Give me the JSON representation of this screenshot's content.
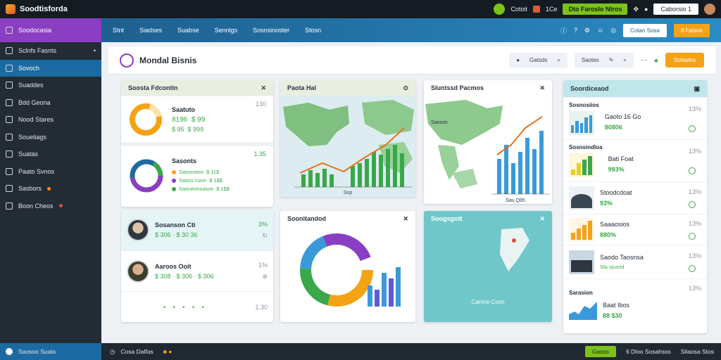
{
  "topbar": {
    "app_title": "Soodtisforda",
    "user_a": "Cotoit",
    "user_b": "1Ce",
    "green_label": "Dto Faroslo Ntros",
    "search_btn": "Caborsio 1"
  },
  "sidebar": {
    "header": "Soodocasia",
    "items": [
      {
        "label": "Sclnfs Fasnts"
      },
      {
        "label": "Sovoch"
      },
      {
        "label": "Suaddes"
      },
      {
        "label": "Bdd Geona"
      },
      {
        "label": "Nood Stares"
      },
      {
        "label": "Souetiags"
      },
      {
        "label": "Suatas"
      },
      {
        "label": "Paato Svnos"
      },
      {
        "label": "Sasbors"
      },
      {
        "label": "Boon Cheos"
      }
    ]
  },
  "nav": {
    "links": [
      "Stnt",
      "Siadses",
      "Suabse",
      "Sennlgs",
      "Sosnsinoster",
      "Stosn"
    ],
    "btn_white": "Cotan Sosa",
    "btn_orange": "8 Fatson"
  },
  "header": {
    "title": "Mondal Bisnis",
    "search1": "Gatsds",
    "search2": "Saotes",
    "stats_btn": "Sotastos"
  },
  "panels": {
    "summary": {
      "title": "Soosta Fdcontin",
      "card1_title": "Saatuto",
      "card1_value": "8196",
      "card1_values": [
        "$ 95",
        "$ 99",
        "$ 999"
      ],
      "card1_side": "130",
      "card2_title": "Sasonts",
      "card2_side": "1.35",
      "legend": [
        "Sasonsioo",
        "$ 11$",
        "Sasos cuon",
        "$ 1$$",
        "Sasneonsasse",
        "$ 1$$"
      ]
    },
    "people": {
      "row1_name": "Sosanson Cti",
      "row1_values": "$ 306 · $ 30 36",
      "row1_side": "3%",
      "row2_name": "Aaroos Ooit",
      "row2_values": "$ 308 · $ 306 · $ 306",
      "row2_side": "1%",
      "row3_side": "1.30"
    },
    "map": {
      "title": "Paota Hal",
      "axis": "Sop"
    },
    "world": {
      "title": "Sluntssd Pacmos",
      "label": "Saoson",
      "footer": "Sau Q95"
    },
    "donut": {
      "title": "Soonitandod"
    },
    "sea": {
      "title": "Soogsgott",
      "label": "Carmoi Coon"
    },
    "right": {
      "title": "Soordiceaod",
      "rows": [
        {
          "title": "Sosnosiios",
          "name": "Gaoto 16 Go",
          "value": "80806",
          "pct": "13%",
          "kind": "bar"
        },
        {
          "title": "Sosnsindloa",
          "name": "Bati Foat",
          "value": "993%",
          "pct": "13%",
          "kind": "bar2"
        },
        {
          "title": "",
          "name": "Stoodcdoat",
          "value": "93%",
          "pct": "13%",
          "kind": "person"
        },
        {
          "title": "",
          "name": "Saaaosios",
          "value": "880%",
          "pct": "13%",
          "kind": "bar3"
        },
        {
          "title": "",
          "name": "Saodo Taosnsa",
          "value": "Sla sjusrid",
          "pct": "13%",
          "kind": "photo"
        },
        {
          "title": "Sarasion",
          "name": "Baat Ibos",
          "value": "88 $30",
          "pct": "13%",
          "kind": "area"
        }
      ]
    }
  },
  "footer": {
    "left": "Saosoo Suala",
    "center": "Cosa Dalfas",
    "btn": "Gasss",
    "right": "6 Dloo Sosahsss",
    "right2": "Silaosa Stos"
  },
  "colors": {
    "accent": "#8a3fc2",
    "nav": "#1f5f8f",
    "orange": "#f4a316",
    "green": "#7cc219"
  }
}
